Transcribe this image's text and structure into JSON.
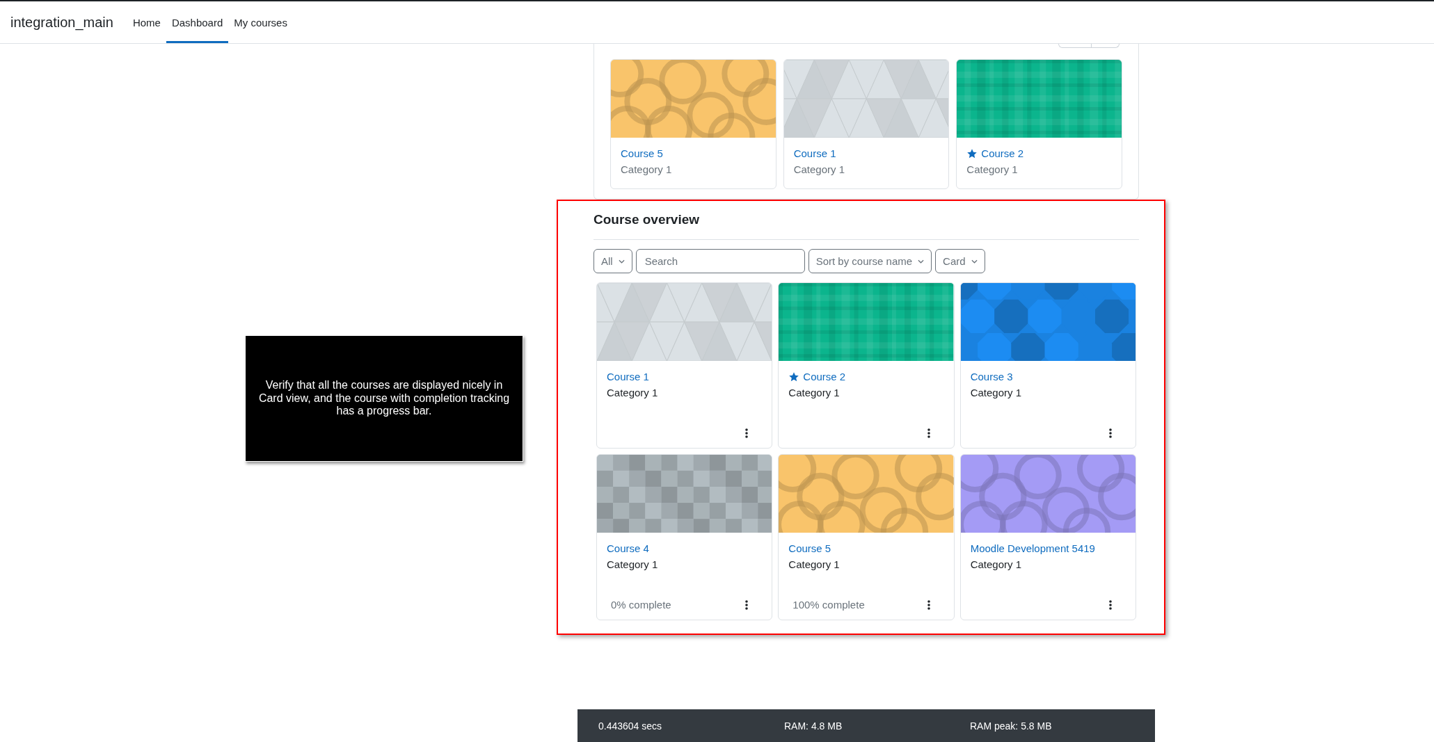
{
  "navbar": {
    "brand": "integration_main",
    "links": [
      {
        "label": "Home",
        "selected": false
      },
      {
        "label": "Dashboard",
        "selected": true
      },
      {
        "label": "My courses",
        "selected": false
      }
    ]
  },
  "recent_courses": [
    {
      "name": "Course 5",
      "category": "Category 1",
      "starred": false,
      "kind": "circles",
      "color": "#f9c46b"
    },
    {
      "name": "Course 1",
      "category": "Category 1",
      "starred": false,
      "kind": "triangles",
      "color": "#dbe1e5"
    },
    {
      "name": "Course 2",
      "category": "Category 1",
      "starred": true,
      "kind": "plaid",
      "color": "#0bb58d"
    }
  ],
  "course_overview": {
    "title": "Course overview",
    "filters": {
      "grouping": "All",
      "search_placeholder": "Search",
      "sort": "Sort by course name",
      "view": "Card"
    },
    "courses": [
      {
        "name": "Course 1",
        "category": "Category 1",
        "starred": false,
        "kind": "triangles",
        "color": "#dbe1e5"
      },
      {
        "name": "Course 2",
        "category": "Category 1",
        "starred": true,
        "kind": "plaid",
        "color": "#0bb58d"
      },
      {
        "name": "Course 3",
        "category": "Category 1",
        "starred": false,
        "kind": "octagons",
        "color": "#1a82e0"
      },
      {
        "name": "Course 4",
        "category": "Category 1",
        "starred": false,
        "kind": "squares",
        "color": "#b2bcc1",
        "progress": "0% complete"
      },
      {
        "name": "Course 5",
        "category": "Category 1",
        "starred": false,
        "kind": "circles",
        "color": "#f9c46b",
        "progress": "100% complete"
      },
      {
        "name": "Moodle Development 5419",
        "category": "Category 1",
        "starred": false,
        "kind": "circles",
        "color": "#a49bf5"
      }
    ]
  },
  "tour_step": {
    "text": "Verify that all the courses are displayed nicely in Card view, and the course with completion tracking has a progress bar."
  },
  "footer": {
    "items": [
      "0.443604 secs",
      "RAM: 4.8 MB",
      "RAM peak: 5.8 MB"
    ]
  }
}
